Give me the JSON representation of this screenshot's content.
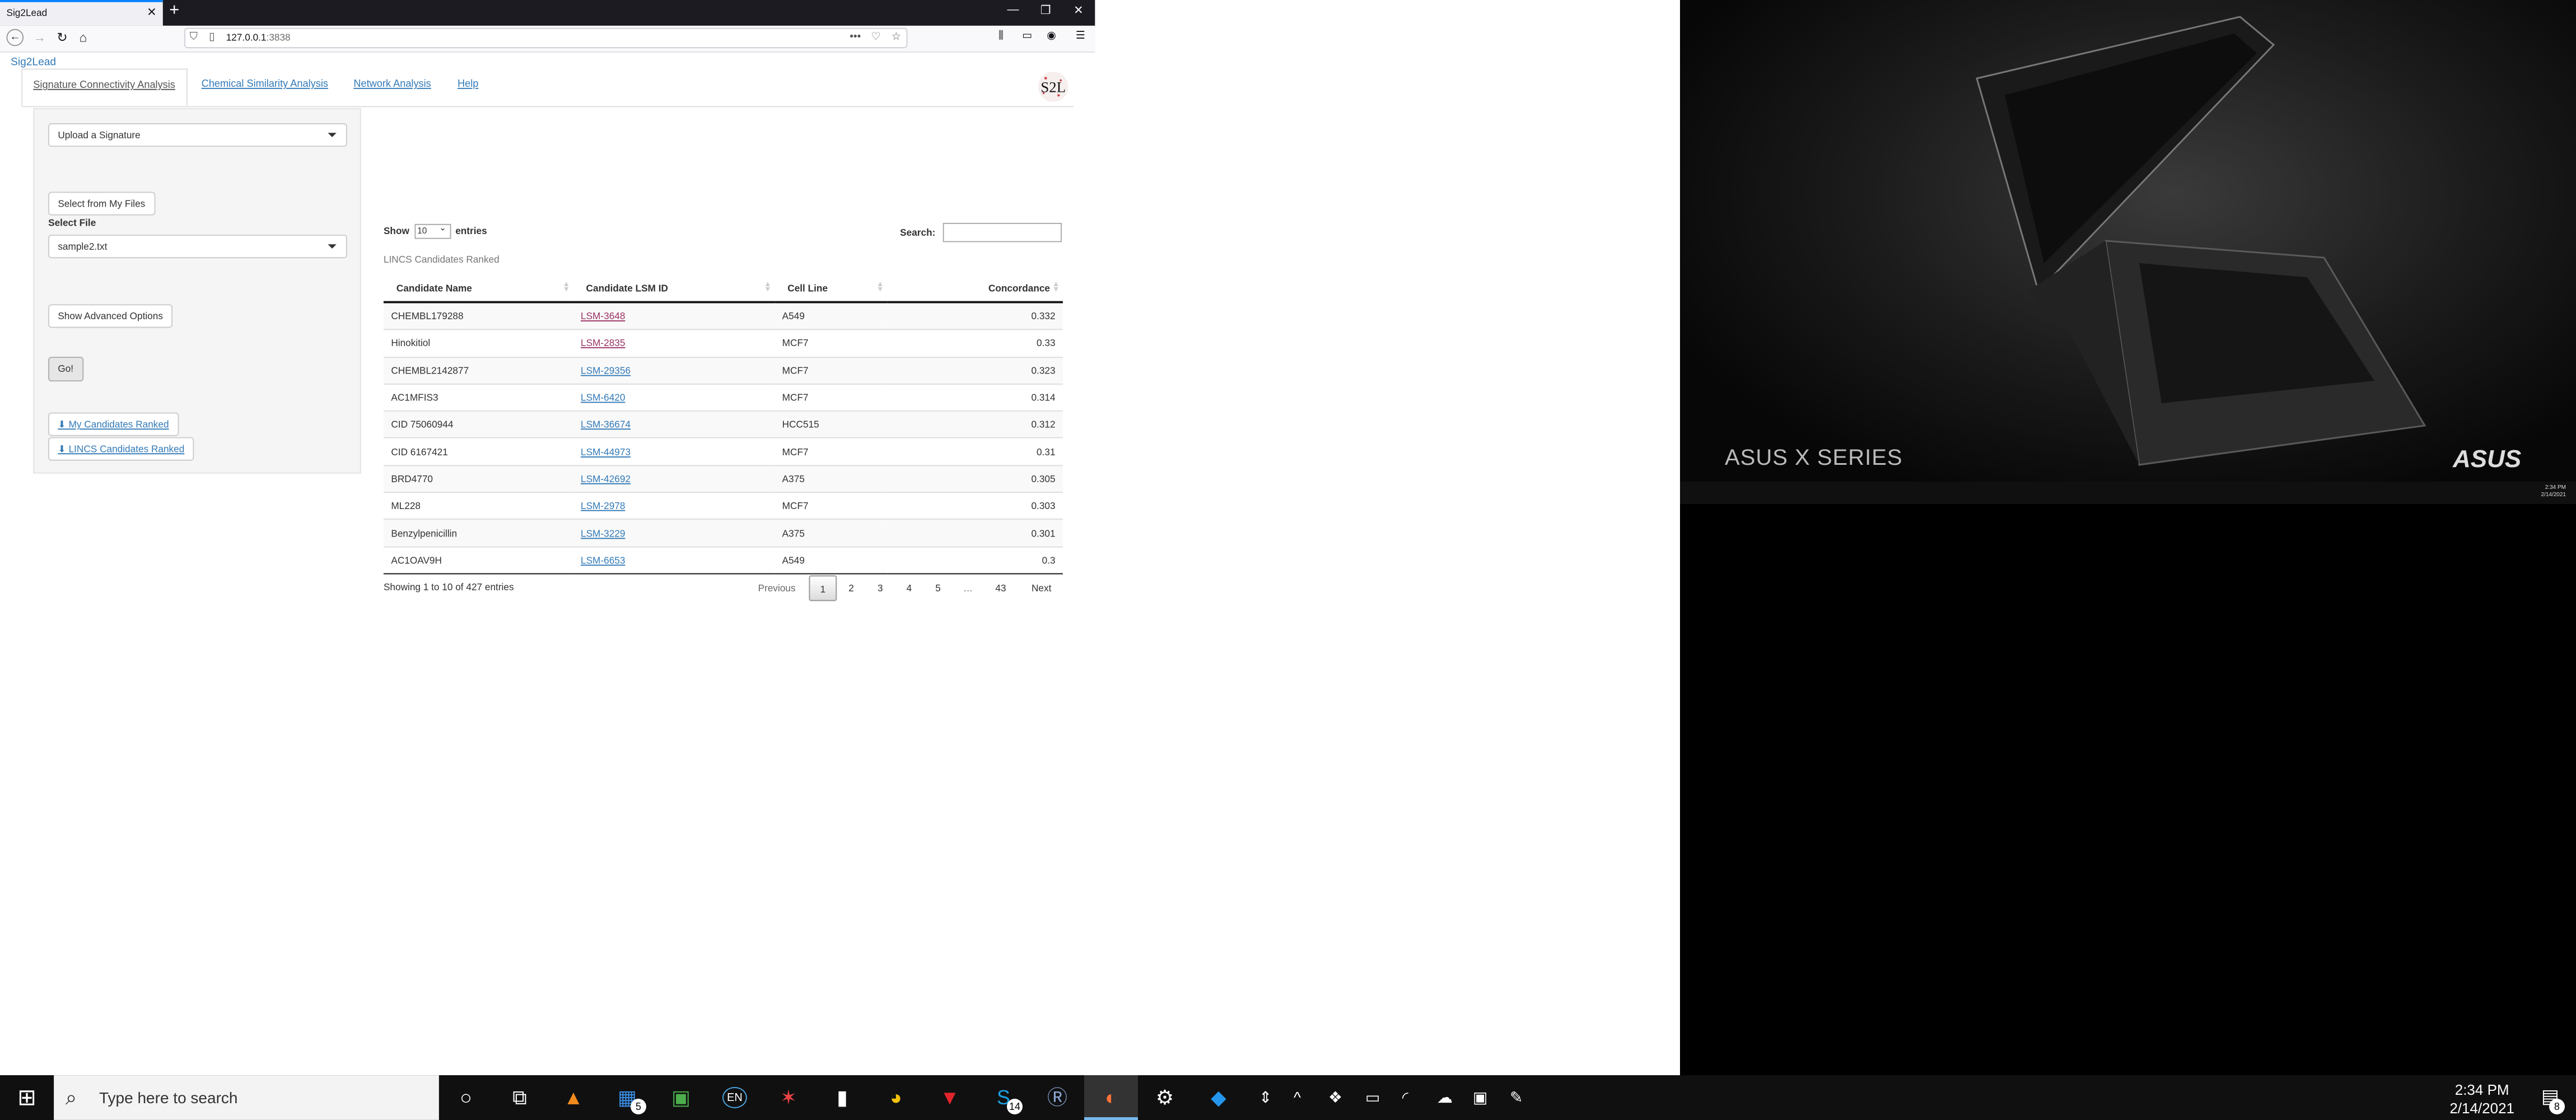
{
  "browser": {
    "tab_title": "Sig2Lead",
    "tab_close": "✕",
    "new_tab": "+",
    "url_host": "127.0.0.1",
    "url_port": ":3838"
  },
  "app": {
    "brand": "Sig2Lead",
    "logo_text": "S2L",
    "tabs": [
      {
        "label": "Signature Connectivity Analysis"
      },
      {
        "label": "Chemical Similarity Analysis"
      },
      {
        "label": "Network Analysis"
      },
      {
        "label": "Help"
      }
    ],
    "sidebar": {
      "signature_select": "Upload a Signature",
      "select_files_button": "Select from My Files",
      "select_file_label": "Select File",
      "file_select": "sample2.txt",
      "advanced_button": "Show Advanced Options",
      "go_button": "Go!",
      "download_mine": "My Candidates Ranked",
      "download_lincs": "LINCS Candidates Ranked"
    },
    "table": {
      "show_label": "Show",
      "entries_label": "entries",
      "page_length": "10",
      "search_label": "Search:",
      "caption": "LINCS Candidates Ranked",
      "columns": [
        "Candidate Name",
        "Candidate LSM ID",
        "Cell Line",
        "Concordance"
      ],
      "rows": [
        {
          "name": "CHEMBL179288",
          "lsm": "LSM-3648",
          "cell": "A549",
          "conc": "0.332"
        },
        {
          "name": "Hinokitiol",
          "lsm": "LSM-2835",
          "cell": "MCF7",
          "conc": "0.33"
        },
        {
          "name": "CHEMBL2142877",
          "lsm": "LSM-29356",
          "cell": "MCF7",
          "conc": "0.323"
        },
        {
          "name": "AC1MFIS3",
          "lsm": "LSM-6420",
          "cell": "MCF7",
          "conc": "0.314"
        },
        {
          "name": "CID 75060944",
          "lsm": "LSM-36674",
          "cell": "HCC515",
          "conc": "0.312"
        },
        {
          "name": "CID 6167421",
          "lsm": "LSM-44973",
          "cell": "MCF7",
          "conc": "0.31"
        },
        {
          "name": "BRD4770",
          "lsm": "LSM-42692",
          "cell": "A375",
          "conc": "0.305"
        },
        {
          "name": "ML228",
          "lsm": "LSM-2978",
          "cell": "MCF7",
          "conc": "0.303"
        },
        {
          "name": "Benzylpenicillin",
          "lsm": "LSM-3229",
          "cell": "A375",
          "conc": "0.301"
        },
        {
          "name": "AC1OAV9H",
          "lsm": "LSM-6653",
          "cell": "A549",
          "conc": "0.3"
        }
      ],
      "info": "Showing 1 to 10 of 427 entries",
      "pagination": {
        "previous": "Previous",
        "pages": [
          "1",
          "2",
          "3",
          "4",
          "5",
          "…",
          "43"
        ],
        "next": "Next"
      }
    }
  },
  "desktop": {
    "series_text": "ASUS X SERIES",
    "brand_text": "ASUS",
    "mini_clock_time": "2:34 PM",
    "mini_clock_date": "2/14/2021"
  },
  "taskbar": {
    "search_placeholder": "Type here to search",
    "clock_time": "2:34 PM",
    "clock_date": "2/14/2021",
    "badges": {
      "calendar": "5",
      "skype": "14",
      "notifications": "8"
    },
    "language": "EN"
  },
  "colors": {
    "link": "#337ab7",
    "visited_link": "#9b3565",
    "tab_accent": "#0a84ff"
  }
}
